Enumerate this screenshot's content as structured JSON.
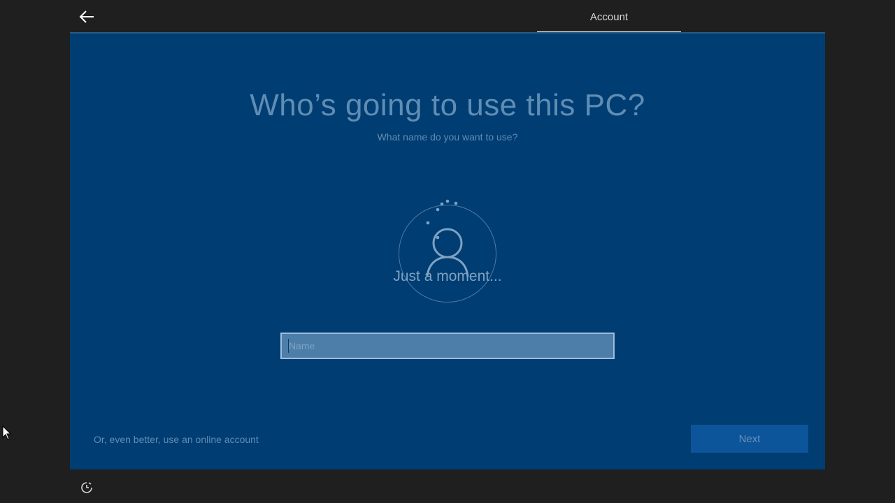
{
  "header": {
    "back_icon": "arrow-left-icon",
    "active_tab": "Account"
  },
  "main": {
    "title": "Who’s going to use this PC?",
    "subtitle": "What name do you want to use?",
    "loading_text": "Just a moment...",
    "avatar_icon": "user-icon",
    "spinner_icon": "loading-dots-icon",
    "name_input": {
      "placeholder": "Name",
      "value": ""
    }
  },
  "footer": {
    "online_account_link": "Or, even better, use an online account",
    "next_label": "Next",
    "accessibility_icon": "ease-of-access-icon"
  },
  "colors": {
    "background": "#1f1f1f",
    "panel": "#003d72",
    "accent_button": "#0c559a",
    "muted_text": "#5f8db4"
  }
}
